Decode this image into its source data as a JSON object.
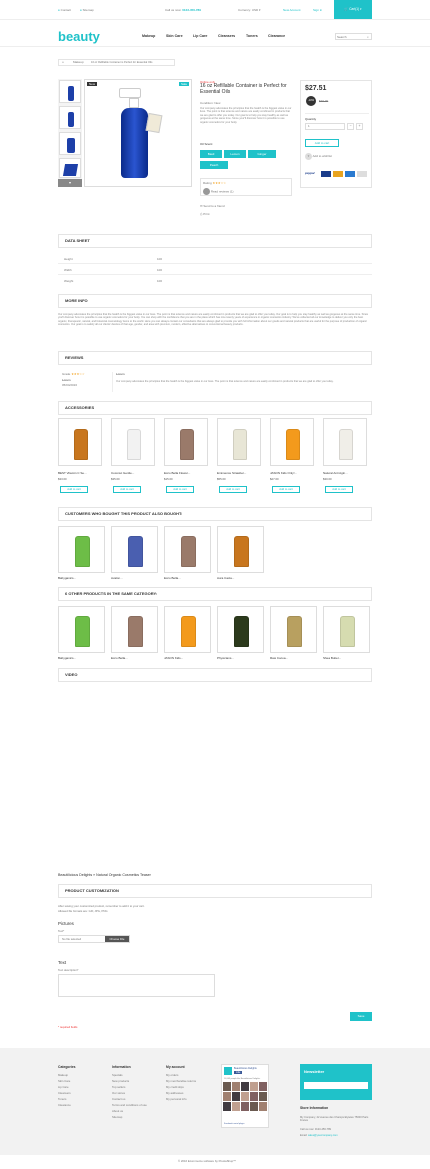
{
  "topbar": {
    "contact": "Contact",
    "sitemap": "Sitemap",
    "call_label": "Call us now:",
    "phone": "0123-456-789",
    "currency_label": "Currency:",
    "currency": "USD",
    "new_account": "New Account",
    "sign_in": "Sign in",
    "cart": "Cart(1)"
  },
  "brand": {
    "logo": "beauty"
  },
  "nav": [
    "Makeup",
    "Skin Care",
    "Lip Care",
    "Cleansers",
    "Toners",
    "Clearance"
  ],
  "search": {
    "placeholder": "Search"
  },
  "breadcrumb": {
    "home": "⌂",
    "category": "Makeup",
    "current": "16 oz Refillable Container is Perfect for Essential Oils"
  },
  "product": {
    "new_badge": "New",
    "sale_badge": "Sale",
    "online_only": "Online only",
    "title": "16 oz Refillable Container is Perfect for Essential Oils",
    "condition_label": "Condition:",
    "condition": "New",
    "description": "Our company advocates the principles that the health is the biggest value in our lives. The point is that science and nature are easily combined in products that we are glad to offer you today. Our goal is to help you stay healthy as well as gorgeous at the same time. Since your'll discover how it is possible to use organic cosmetics for your body.",
    "options_label": "Oil Scent:",
    "options": [
      "Basil",
      "Lemon",
      "Ginger",
      "Peach"
    ],
    "rating_label": "Rating",
    "read_reviews": "Read reviews (1)",
    "send_friend": "Send to a friend",
    "print": "Print"
  },
  "buybox": {
    "price": "$27.51",
    "discount": "-10%",
    "old_price": "$30.00",
    "quantity_label": "Quantity",
    "quantity": "1",
    "add_to_cart": "Add to cart",
    "wishlist": "Add to wishlist"
  },
  "sections": {
    "data_sheet": "Data sheet",
    "more_info": "More info",
    "reviews": "Reviews",
    "accessories": "Accessories",
    "also_bought": "Customers who bought this product also bought:",
    "same_category": "6 other products in the same category:",
    "video": "Video",
    "customization": "Product customization"
  },
  "data_sheet": [
    {
      "k": "Height",
      "v": "100"
    },
    {
      "k": "Width",
      "v": "100"
    },
    {
      "k": "Weight",
      "v": "100"
    }
  ],
  "more_info_text": "Our company advocates the principles that the health is the biggest value in our lives. The point is that science and nature are easily combined in products that we are glad to offer you today. Our goal is to help you stay healthy as well as gorgeous at the same time. Since you'll discover how it is possible to use organic cosmetics for your body. You can shop with the confidence that you are in the place which has nine twenty years of experience in organic cosmetics industry. We've collected all our knowledge to deliver you only the best organic, therapeutic, natural, and botanical cosmetology items to the world. Here you can always contact our consultants that are always glad to provide you with full information about our goods and natural products that are useful for the purpose of production of organic cosmetics. Our goal is to satisfy all our clients' desires of that age, gender, and area with premium, modern, effective alternatives to conventional beauty products.",
  "review": {
    "grade_label": "Grade",
    "author": "Lorem",
    "when": "05/04/2016",
    "title": "Lorem",
    "text": "Our company advocates the principles that the health is the biggest value in our lives. The point is that science and nature are easily combined in products that we are glad to offer you today."
  },
  "accessories": [
    {
      "name": "BEST Vitamin C Se...",
      "price": "$33.00",
      "c": "#c8761e"
    },
    {
      "name": "Coconut Gentle...",
      "price": "$35.00",
      "c": "#f2f2f2"
    },
    {
      "name": "Ecco Bella Flower...",
      "price": "$15.00",
      "c": "#9a7a6a"
    },
    {
      "name": "Emimence Strawber...",
      "price": "$55.00",
      "c": "#e8e6d6"
    },
    {
      "name": "JASON Kids Only!...",
      "price": "$27.00",
      "c": "#f39a1c"
    },
    {
      "name": "Natural Anti Agin...",
      "price": "$30.00",
      "c": "#f0eee8"
    }
  ],
  "accessory_button": "Add to cart",
  "also_bought": [
    {
      "name": "Babyganics...",
      "c": "#6dbd47"
    },
    {
      "name": "Avalon...",
      "c": "#4a5fb0"
    },
    {
      "name": "Ecco Bella...",
      "c": "#9a7a6a"
    },
    {
      "name": "Aura Cacia...",
      "c": "#c8761e"
    }
  ],
  "same_category": [
    {
      "name": "Babyganics...",
      "c": "#6dbd47"
    },
    {
      "name": "Ecco Bella...",
      "c": "#9a7a6a"
    },
    {
      "name": "JASON Kids...",
      "c": "#f39a1c"
    },
    {
      "name": "Physicians...",
      "c": "#2c3a1c"
    },
    {
      "name": "Raw Cocoa...",
      "c": "#b8a060"
    },
    {
      "name": "Shea Butter...",
      "c": "#d6dcb0"
    }
  ],
  "teaser": "Beautilicious Delights » Natural Organic Cosmetics Teaser",
  "customization": {
    "note1": "After saving your customized product, remember to add it to your cart.",
    "note2": "Allowed file formats are: GIF, JPG, PNG",
    "pictures": "Pictures",
    "text_field": "Text*",
    "no_file": "No file selected",
    "choose": "Choose File",
    "text": "Text",
    "text_desc": "Text description*",
    "required": "* required fields",
    "save": "Save"
  },
  "footer": {
    "categories_title": "Categories",
    "categories": [
      "Makeup",
      "Skin Care",
      "Lip Care",
      "Cleansers",
      "Toners",
      "Clearance"
    ],
    "info_title": "Information",
    "info": [
      "Specials",
      "New products",
      "Top sellers",
      "Our stores",
      "Contact us",
      "Terms and conditions of use",
      "About us",
      "Sitemap"
    ],
    "account_title": "My account",
    "account": [
      "My orders",
      "My merchandise returns",
      "My credit slips",
      "My addresses",
      "My personal info"
    ],
    "social_name": "Beautilicious Delights",
    "social_like": "Like",
    "fans": "10,543 people like Beautilicious Delights.",
    "fb_plugin": "Facebook social plugin",
    "newsletter": "Newsletter",
    "store_title": "Store Information",
    "store_address": "My Company, 42 avenue des Champs Elysées 75000 Paris France",
    "store_phone": "Call us now: 0123-456-789",
    "store_email": "sales@yourcompany.com",
    "copyright": "© 2016 Ecommerce software by PrestaShop™"
  },
  "colors": {
    "accent": "#1fc2c9",
    "text": "#333333"
  }
}
